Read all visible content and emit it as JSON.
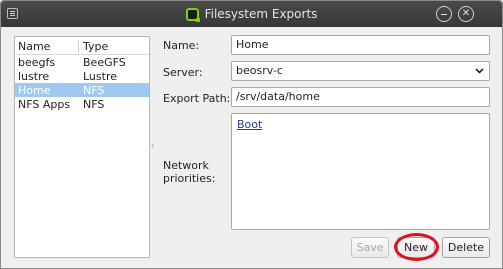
{
  "window": {
    "title": "Filesystem Exports",
    "minimize_symbol": "",
    "close_symbol": "✕"
  },
  "list": {
    "headers": {
      "name": "Name",
      "type": "Type"
    },
    "rows": [
      {
        "name": "beegfs",
        "type": "BeeGFS",
        "selected": false
      },
      {
        "name": "lustre",
        "type": "Lustre",
        "selected": false
      },
      {
        "name": "Home",
        "type": "NFS",
        "selected": true
      },
      {
        "name": "NFS Apps",
        "type": "NFS",
        "selected": false
      }
    ]
  },
  "form": {
    "name_label": "Name:",
    "name_value": "Home",
    "server_label": "Server:",
    "server_value": "beosrv-c",
    "export_path_label": "Export Path:",
    "export_path_value": "/srv/data/home",
    "network_priorities_label_line1": "Network",
    "network_priorities_label_line2": "priorities:",
    "network_priorities_items": [
      "Boot"
    ]
  },
  "buttons": {
    "save": "Save",
    "new": "New",
    "delete": "Delete"
  },
  "colors": {
    "selection": "#9fc9ef",
    "highlight_ring": "#e01020",
    "titlebar": "#3c3c3c"
  }
}
